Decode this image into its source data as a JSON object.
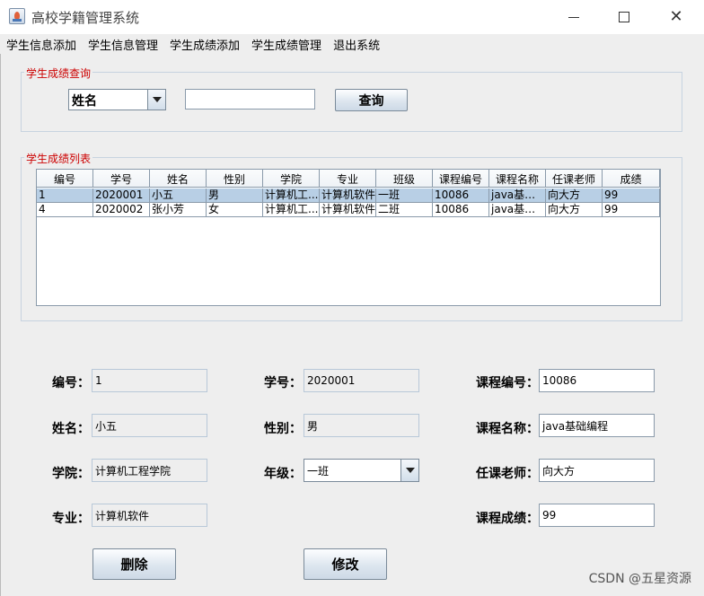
{
  "window": {
    "title": "高校学籍管理系统"
  },
  "menu": [
    "学生信息添加",
    "学生信息管理",
    "学生成绩添加",
    "学生成绩管理",
    "退出系统"
  ],
  "query": {
    "group_title": "学生成绩查询",
    "field_selected": "姓名",
    "input_value": "",
    "button_label": "查询"
  },
  "list": {
    "group_title": "学生成绩列表",
    "columns": [
      "编号",
      "学号",
      "姓名",
      "性别",
      "学院",
      "专业",
      "班级",
      "课程编号",
      "课程名称",
      "任课老师",
      "成绩"
    ],
    "rows": [
      [
        "1",
        "2020001",
        "小五",
        "男",
        "计算机工...",
        "计算机软件",
        "一班",
        "10086",
        "java基础...",
        "向大方",
        "99"
      ],
      [
        "4",
        "2020002",
        "张小芳",
        "女",
        "计算机工...",
        "计算机软件",
        "二班",
        "10086",
        "java基础...",
        "向大方",
        "99"
      ]
    ],
    "selected_row": 0
  },
  "form": {
    "id": {
      "label": "编号：",
      "value": "1"
    },
    "student_no": {
      "label": "学号：",
      "value": "2020001"
    },
    "course_no": {
      "label": "课程编号：",
      "value": "10086"
    },
    "name": {
      "label": "姓名：",
      "value": "小五"
    },
    "gender": {
      "label": "性别：",
      "value": "男"
    },
    "course_name": {
      "label": "课程名称：",
      "value": "java基础编程"
    },
    "college": {
      "label": "学院：",
      "value": "计算机工程学院"
    },
    "grade": {
      "label": "年级：",
      "value": "一班"
    },
    "teacher": {
      "label": "任课老师：",
      "value": "向大方"
    },
    "major": {
      "label": "专业：",
      "value": "计算机软件"
    },
    "score": {
      "label": "课程成绩：",
      "value": "99"
    },
    "delete_label": "删除",
    "modify_label": "修改"
  },
  "watermark": "CSDN @五星资源"
}
